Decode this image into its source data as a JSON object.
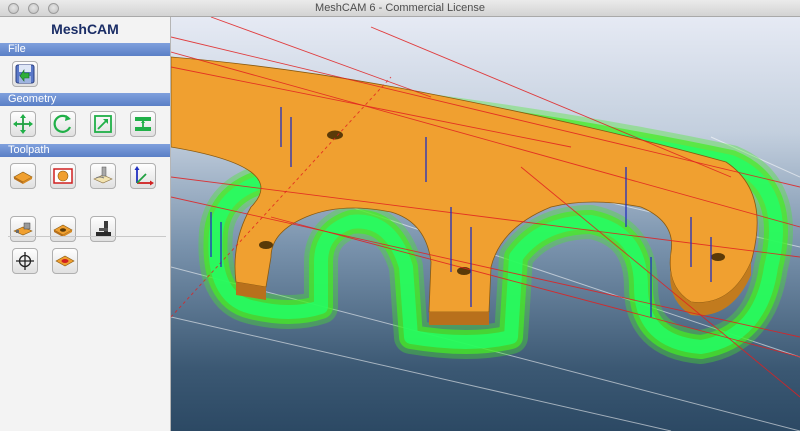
{
  "window": {
    "title": "MeshCAM 6 - Commercial License"
  },
  "panel": {
    "app_name": "MeshCAM",
    "sections": {
      "file": "File",
      "geometry": "Geometry",
      "toolpath": "Toolpath"
    }
  },
  "icons": {
    "file": [
      "open-file-icon"
    ],
    "geometry": [
      "move-icon",
      "rotate-icon",
      "scale-icon",
      "mirror-icon"
    ],
    "toolpath_row1": [
      "stock-icon",
      "region-icon",
      "machining-icon",
      "origin-axes-icon"
    ],
    "toolpath_row2": [
      "holding-tabs-icon",
      "drill-icon",
      "post-process-icon"
    ],
    "misc": [
      "crosshair-icon",
      "pencil-region-icon"
    ]
  },
  "colors": {
    "section_header": "#5a7fc6",
    "part": "#f0a030",
    "toolpath_green": "#44ee22",
    "rapid_red": "#e02020",
    "plunge_blue": "#2030c0"
  }
}
